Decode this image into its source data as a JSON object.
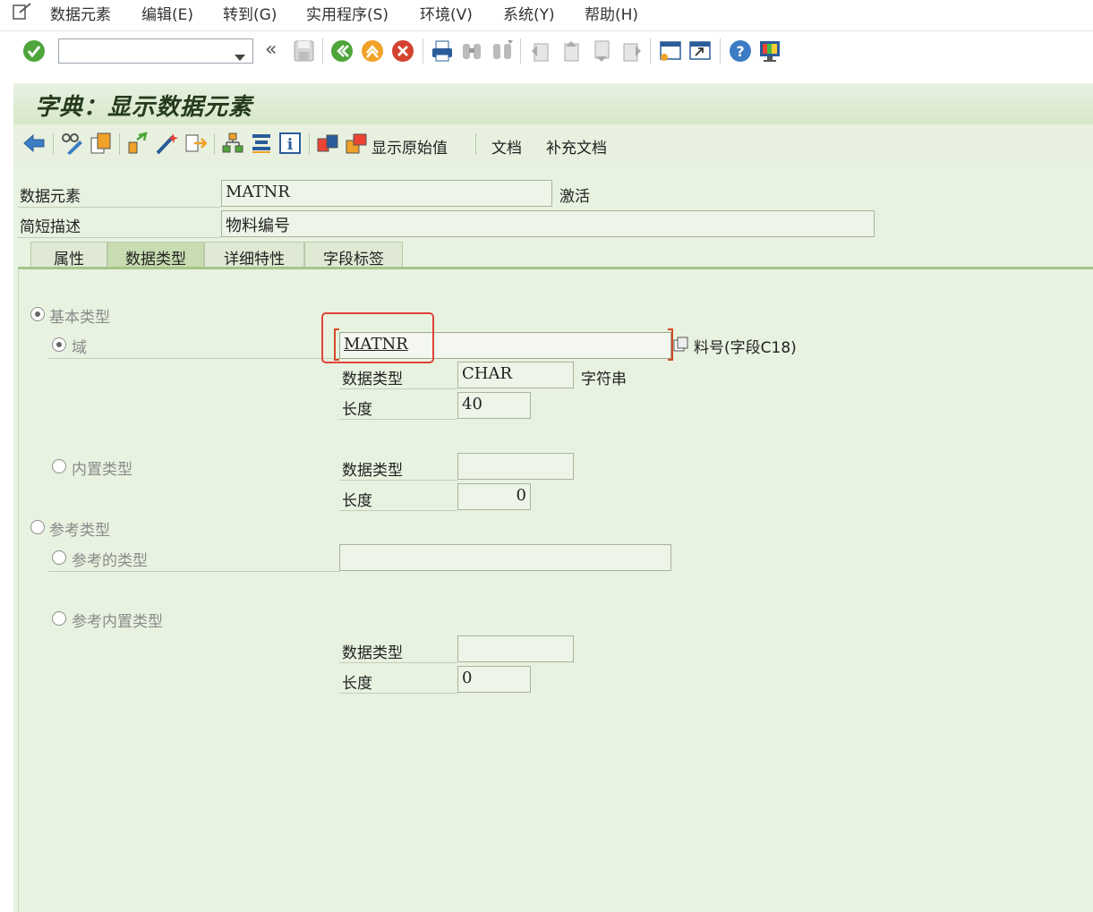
{
  "menu": {
    "items": [
      "数据元素",
      "编辑(E)",
      "转到(G)",
      "实用程序(S)",
      "环境(V)",
      "系统(Y)",
      "帮助(H)"
    ]
  },
  "toolbar": {
    "command_field_value": "",
    "collapse_glyph": "«",
    "icons": [
      "enter-icon",
      "save-icon",
      "back-icon",
      "exit-icon",
      "cancel-icon",
      "print-icon",
      "find-icon",
      "find-next-icon",
      "first-page-icon",
      "previous-page-icon",
      "next-page-icon",
      "last-page-icon",
      "new-session-icon",
      "shortcut-icon",
      "help-icon",
      "customize-layout-icon"
    ]
  },
  "title": "字典：显示数据元素",
  "app_toolbar": {
    "icons": [
      "back-arrow-icon",
      "display-change-icon",
      "other-object-icon",
      "check-icon",
      "activate-icon",
      "test-icon",
      "hierarchy-icon",
      "where-used-icon",
      "info-icon",
      "documentation-icon"
    ],
    "show_original_label": "显示原始值",
    "doc_label": "文档",
    "supp_doc_label": "补充文档"
  },
  "header": {
    "element_label": "数据元素",
    "element_value": "MATNR",
    "status": "激活",
    "short_desc_label": "简短描述",
    "short_desc_value": "物料编号"
  },
  "tabs": [
    "属性",
    "数据类型",
    "详细特性",
    "字段标签"
  ],
  "active_tab": 1,
  "form": {
    "elementary_type": "基本类型",
    "domain": "域",
    "domain_value": "MATNR",
    "domain_desc": "料号(字段C18)",
    "data_type_label": "数据类型",
    "data_type_value": "CHAR",
    "data_type_desc": "字符串",
    "length_label": "长度",
    "length_value": "40",
    "builtin_type": "内置类型",
    "builtin_data_type_label": "数据类型",
    "builtin_data_type_value": "",
    "builtin_length_label": "长度",
    "builtin_length_value": "0",
    "reference_type": "参考类型",
    "ref_type_name": "参考的类型",
    "ref_type_value": "",
    "ref_builtin_type": "参考内置类型",
    "ref_data_type_label": "数据类型",
    "ref_data_type_value": "",
    "ref_length_label": "长度",
    "ref_length_value": "0"
  },
  "colors": {
    "background": "#e8f2e0",
    "title_green": "#d7e7c9",
    "highlight_red": "#e0443a"
  }
}
